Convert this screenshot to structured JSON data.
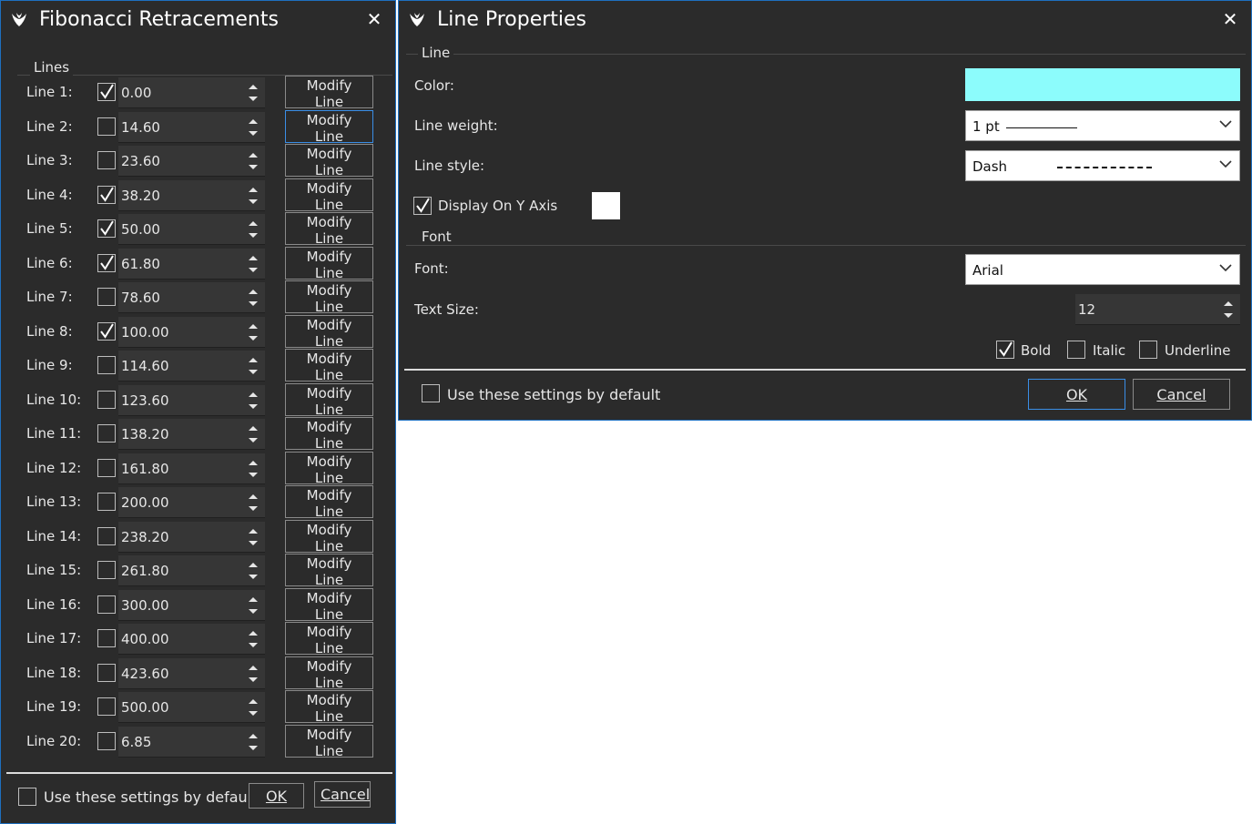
{
  "fibonacci": {
    "title": "Fibonacci Retracements",
    "group_title": "Lines",
    "modify_label": "Modify Line",
    "lines": [
      {
        "label": "Line 1:",
        "checked": true,
        "value": "0.00"
      },
      {
        "label": "Line 2:",
        "checked": false,
        "value": "14.60"
      },
      {
        "label": "Line 3:",
        "checked": false,
        "value": "23.60"
      },
      {
        "label": "Line 4:",
        "checked": true,
        "value": "38.20"
      },
      {
        "label": "Line 5:",
        "checked": true,
        "value": "50.00"
      },
      {
        "label": "Line 6:",
        "checked": true,
        "value": "61.80"
      },
      {
        "label": "Line 7:",
        "checked": false,
        "value": "78.60"
      },
      {
        "label": "Line 8:",
        "checked": true,
        "value": "100.00"
      },
      {
        "label": "Line 9:",
        "checked": false,
        "value": "114.60"
      },
      {
        "label": "Line 10:",
        "checked": false,
        "value": "123.60"
      },
      {
        "label": "Line 11:",
        "checked": false,
        "value": "138.20"
      },
      {
        "label": "Line 12:",
        "checked": false,
        "value": "161.80"
      },
      {
        "label": "Line 13:",
        "checked": false,
        "value": "200.00"
      },
      {
        "label": "Line 14:",
        "checked": false,
        "value": "238.20"
      },
      {
        "label": "Line 15:",
        "checked": false,
        "value": "261.80"
      },
      {
        "label": "Line 16:",
        "checked": false,
        "value": "300.00"
      },
      {
        "label": "Line 17:",
        "checked": false,
        "value": "400.00"
      },
      {
        "label": "Line 18:",
        "checked": false,
        "value": "423.60"
      },
      {
        "label": "Line 19:",
        "checked": false,
        "value": "500.00"
      },
      {
        "label": "Line 20:",
        "checked": false,
        "value": "6.85"
      }
    ],
    "default_label": "Use these settings by default",
    "default_checked": false,
    "ok_label": "OK",
    "cancel_label": "Cancel"
  },
  "line_properties": {
    "title": "Line Properties",
    "line_group": "Line",
    "color_label": "Color:",
    "color_value": "#8cfcfc",
    "weight_label": "Line weight:",
    "weight_value": "1 pt",
    "style_label": "Line style:",
    "style_value": "Dash",
    "display_y_label": "Display On Y Axis",
    "display_y_checked": true,
    "display_y_color": "#ffffff",
    "font_group": "Font",
    "font_label": "Font:",
    "font_value": "Arial",
    "text_size_label": "Text Size:",
    "text_size_value": "12",
    "bold_label": "Bold",
    "bold_checked": true,
    "italic_label": "Italic",
    "italic_checked": false,
    "underline_label": "Underline",
    "underline_checked": false,
    "default_label": "Use these settings by default",
    "default_checked": false,
    "ok_label": "OK",
    "cancel_label": "Cancel"
  },
  "colors": {
    "window_bg": "#2b2b2b",
    "border_accent": "#1e6fbf",
    "focus_accent": "#3a8ee6"
  }
}
